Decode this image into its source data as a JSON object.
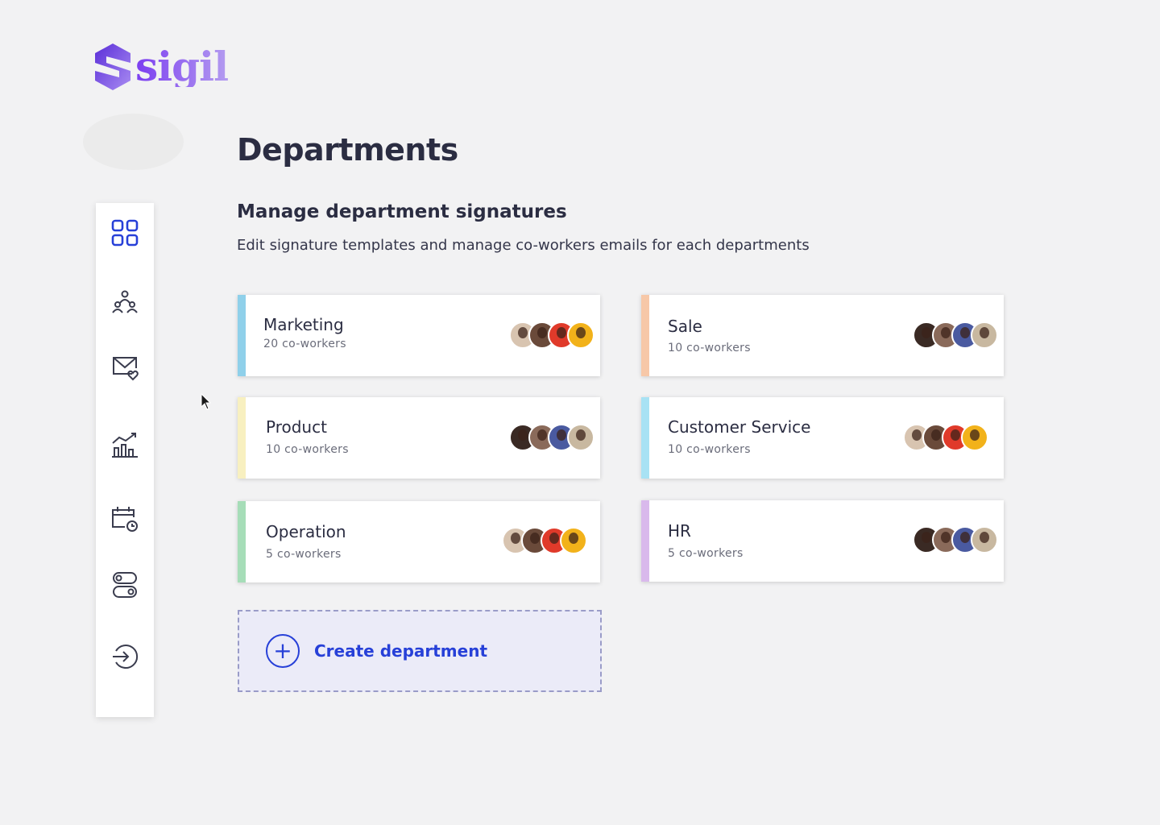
{
  "brand": {
    "name": "sigil",
    "accent": "#7b3df0"
  },
  "page": {
    "title": "Departments",
    "section_title": "Manage department signatures",
    "section_desc": "Edit signature templates and manage co-workers emails for each departments"
  },
  "sidebar": {
    "items": [
      {
        "icon": "dashboard-grid-icon",
        "active": true
      },
      {
        "icon": "team-people-icon"
      },
      {
        "icon": "mail-heart-icon"
      },
      {
        "icon": "analytics-chart-icon"
      },
      {
        "icon": "calendar-clock-icon"
      },
      {
        "icon": "settings-toggle-icon"
      },
      {
        "icon": "logout-icon"
      }
    ]
  },
  "departments": [
    {
      "name": "Marketing",
      "count": "20 co-workers",
      "color": "#8fd0ea"
    },
    {
      "name": "Sale",
      "count": "10 co-workers",
      "color": "#f7c8a8"
    },
    {
      "name": "Product",
      "count": "10 co-workers",
      "color": "#f8f0c0"
    },
    {
      "name": "Customer Service",
      "count": "10 co-workers",
      "color": "#a8e2f4"
    },
    {
      "name": "Operation",
      "count": "5 co-workers",
      "color": "#a6ddb8"
    },
    {
      "name": "HR",
      "count": "5 co-workers",
      "color": "#d9b9ec"
    }
  ],
  "create": {
    "label": "Create department",
    "color": "#2740d8"
  }
}
